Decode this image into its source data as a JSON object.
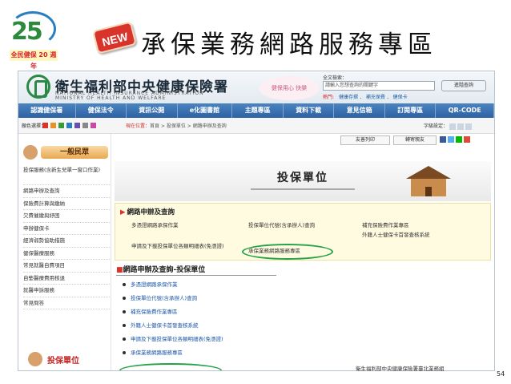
{
  "slide": {
    "logo_number": "25",
    "logo_tag": "全民健保 20 週年",
    "new_badge": "NEW",
    "title": "承保業務網路服務專區",
    "footer": "衛生福利部中央健康保險署臺北業務組",
    "page_number": "54"
  },
  "site": {
    "name": "衛生福利部中央健康保險署",
    "english": "NATIONAL HEALTH INSURANCE ADMINISTRATION\nMINISTRY OF HEALTH AND WELFARE",
    "slogan": "健保用心 快樂",
    "search_label": "全文檢索：",
    "search_placeholder": "請輸入您想查詢的關鍵字",
    "search_button": "進階查詢",
    "hot_label": "熱門:",
    "hot_links": "健康存摺 ． 補充保費 ． 健保卡"
  },
  "nav": [
    "認識健保署",
    "健保法令",
    "資訊公開",
    "e化圖書館",
    "主題專區",
    "資料下載",
    "意見信箱",
    "訂閱專區",
    "QR-CODE"
  ],
  "util": {
    "color_label": "顏色選擇：",
    "swatch_colors": [
      "#d9342b",
      "#e8902a",
      "#3a9a3a",
      "#2a7fc0",
      "#6a4fb0",
      "#888888",
      "#c94aa0"
    ],
    "breadcrumb_label": "現在位置：",
    "breadcrumb_path": "首頁 > 投保單位 > 網路申辦及查詢",
    "font_label": "字級設定："
  },
  "sidebar": {
    "head": "一般民眾",
    "items": [
      "投保服務(含新生兒單一窗口作業)",
      "網路申辦及查詢",
      "保險費計算與繳納",
      "欠費催繳與紓困",
      "申辦健保卡",
      "經濟弱勢協助措施",
      "健保醫療服務",
      "常見就醫自費項目",
      "自墊醫療費用核退",
      "就醫申訴服務",
      "常見問答"
    ],
    "foot": "投保單位"
  },
  "main": {
    "print_label": "友善列印",
    "share_label": "轉寄親友",
    "share_icon_colors": [
      "#3b5998",
      "#55acee",
      "#00b900",
      "#dd4b39"
    ],
    "banner_title": "投保單位",
    "section_title": "網路申辦及查詢",
    "section_cols": [
      [
        "多憑證網路承保作業",
        "申請及下載投保單位各類明細表(免憑證)"
      ],
      [
        "投保單位代號(含承辦人)查詢",
        "承保業務網路服務專區"
      ],
      [
        "補充保險費作業專區",
        "外籍人士健保卡首發查核系統"
      ]
    ],
    "list_title": "網路申辦及查詢-投保單位",
    "list_items": [
      "多憑證網路承保作業",
      "投保單位代號(含承辦人)查詢",
      "補充保險費作業專區",
      "外籍人士健保卡首發查核系統",
      "申請及下載投保單位各類明細表(免憑證)",
      "承保業務網路服務專區"
    ]
  }
}
